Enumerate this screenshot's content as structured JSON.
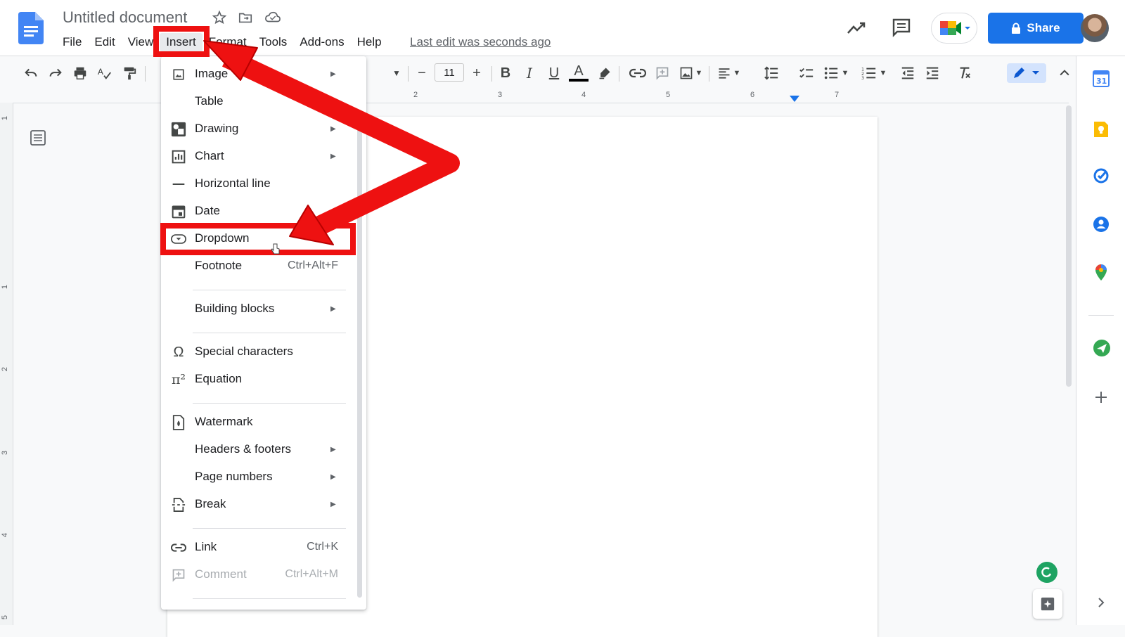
{
  "document": {
    "title": "Untitled document",
    "last_edit": "Last edit was seconds ago"
  },
  "menubar": {
    "items": [
      "File",
      "Edit",
      "View",
      "Insert",
      "Format",
      "Tools",
      "Add-ons",
      "Help"
    ],
    "active": "Insert"
  },
  "header": {
    "share_label": "Share"
  },
  "toolbar": {
    "font_size": "11",
    "decrease_label": "−",
    "increase_label": "+",
    "bold_label": "B",
    "italic_label": "I",
    "underline_label": "U",
    "text_color_label": "A"
  },
  "ruler": {
    "numbers": [
      "2",
      "3",
      "4",
      "5",
      "6",
      "7"
    ],
    "vertical_numbers": [
      "1",
      "1",
      "2",
      "3",
      "4",
      "5"
    ]
  },
  "insert_menu": {
    "items": [
      {
        "label": "Image",
        "icon": "image-icon",
        "submenu": true
      },
      {
        "label": "Table",
        "icon": "",
        "submenu": false
      },
      {
        "label": "Drawing",
        "icon": "drawing-icon",
        "submenu": true
      },
      {
        "label": "Chart",
        "icon": "chart-icon",
        "submenu": true
      },
      {
        "label": "Horizontal line",
        "icon": "horizontal-line-icon",
        "submenu": false
      },
      {
        "label": "Date",
        "icon": "calendar-icon",
        "submenu": false
      },
      {
        "label": "Dropdown",
        "icon": "dropdown-chip-icon",
        "submenu": false
      },
      {
        "label": "Footnote",
        "icon": "",
        "shortcut": "Ctrl+Alt+F"
      },
      {
        "label": "Building blocks",
        "icon": "",
        "submenu": true
      },
      {
        "label": "Special characters",
        "icon": "omega-icon",
        "submenu": false
      },
      {
        "label": "Equation",
        "icon": "pi-icon",
        "submenu": false
      },
      {
        "label": "Watermark",
        "icon": "watermark-icon",
        "submenu": false
      },
      {
        "label": "Headers & footers",
        "icon": "",
        "submenu": true
      },
      {
        "label": "Page numbers",
        "icon": "",
        "submenu": true
      },
      {
        "label": "Break",
        "icon": "break-icon",
        "submenu": true
      },
      {
        "label": "Link",
        "icon": "link-icon",
        "shortcut": "Ctrl+K"
      },
      {
        "label": "Comment",
        "icon": "comment-icon",
        "shortcut": "Ctrl+Alt+M",
        "disabled": true
      }
    ],
    "highlighted": "Dropdown"
  },
  "side_panel": {
    "icons": [
      "google-calendar-icon",
      "google-keep-icon",
      "google-tasks-icon",
      "google-contacts-icon",
      "google-maps-icon",
      "addon-icon",
      "add-icon"
    ]
  },
  "colors": {
    "accent": "#1a73e8",
    "annotation": "#ee1111",
    "doc_blue": "#4285f4"
  }
}
